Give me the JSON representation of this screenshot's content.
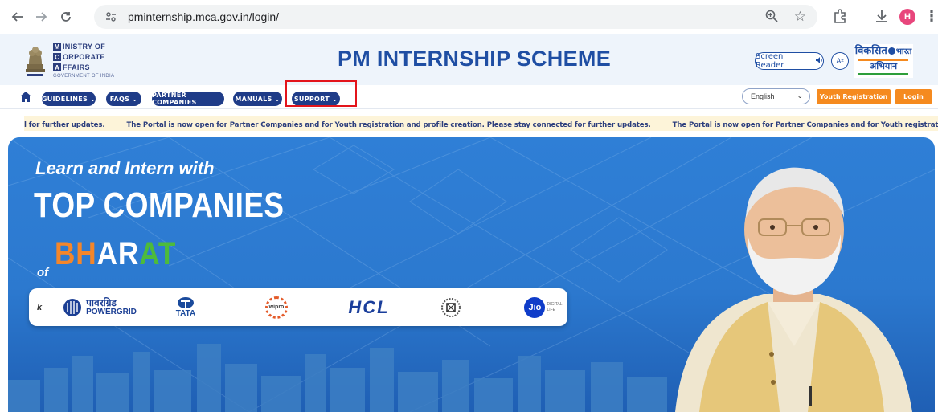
{
  "browser": {
    "url": "pminternship.mca.gov.in/login/",
    "avatar_letter": "H",
    "icons": [
      "back-arrow-icon",
      "forward-arrow-icon",
      "reload-icon",
      "site-settings-icon",
      "zoom-icon",
      "bookmark-star-icon",
      "extensions-icon",
      "download-icon",
      "profile-avatar",
      "more-menu-icon"
    ]
  },
  "header": {
    "ministry_lines": [
      {
        "initial": "M",
        "rest": "INISTRY OF"
      },
      {
        "initial": "C",
        "rest": "ORPORATE"
      },
      {
        "initial": "A",
        "rest": "FFAIRS"
      }
    ],
    "government": "GOVERNMENT OF INDIA",
    "title": "PM INTERNSHIP SCHEME",
    "screen_reader": "Screen Reader",
    "font_size_toggle": "A",
    "viksit_line1": "विकसित",
    "viksit_word": "भारत",
    "viksit_line2": "अभियान",
    "brand_color": "#1f4ea3"
  },
  "nav": {
    "items": [
      "GUIDELINES",
      "FAQS",
      "PARTNER COMPANIES",
      "MANUALS",
      "SUPPORT"
    ],
    "language": "English",
    "youth_registration": "Youth Registration",
    "login": "Login",
    "pill_color": "#1f3c88",
    "button_color": "#f58a1f"
  },
  "ticker": {
    "prefix": "l for further updates.",
    "message": "The Portal is now open for Partner Companies and for Youth registration and profile creation. Please stay connected for further updates.",
    "suffix": "The Portal is now open for Partner Companies and for Youth registration and profile creation. Please"
  },
  "banner": {
    "tagline": "Learn and Intern with",
    "headline": "TOP COMPANIES",
    "of": "of",
    "bharat_1": "BH",
    "bharat_2": "AR",
    "bharat_3": "AT",
    "logos": {
      "k": "k",
      "powergrid_hindi": "पावरग्रिड",
      "powergrid": "POWERGRID",
      "tata": "TATA",
      "wipro": "wipro",
      "hcl": "HCL",
      "jio": "Jio",
      "jio_digital": "DIGITAL",
      "jio_life": "LIFE"
    }
  }
}
